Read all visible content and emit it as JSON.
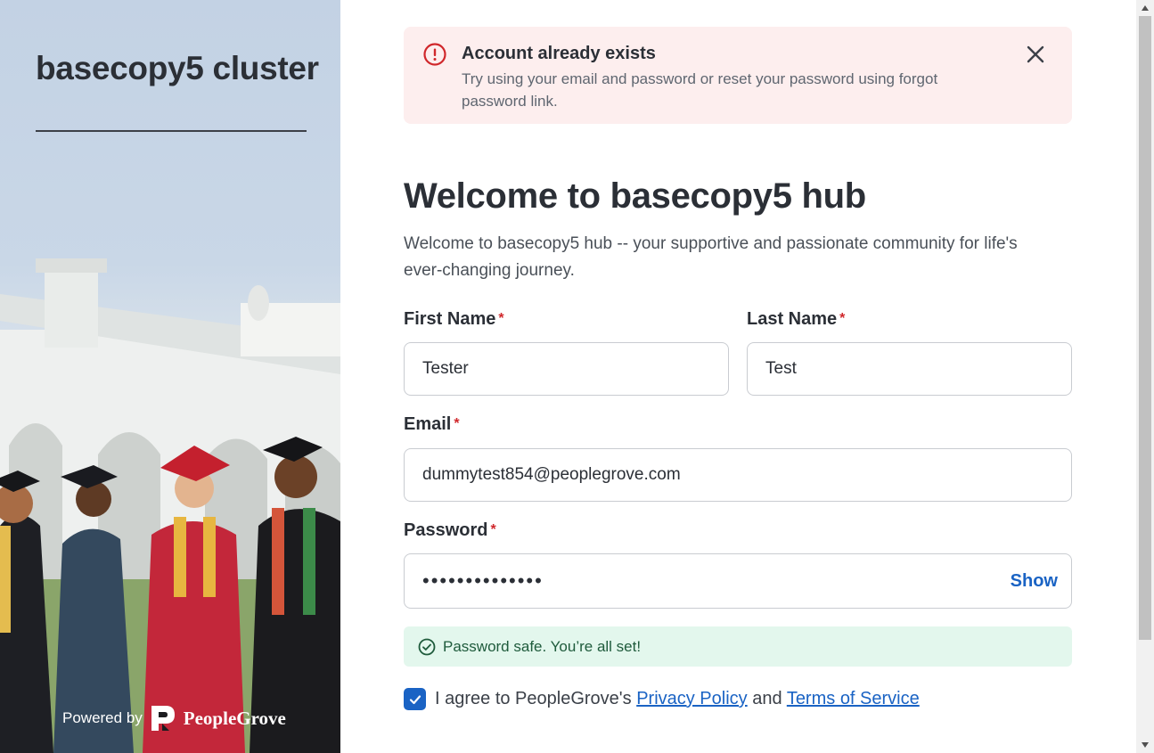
{
  "left_panel": {
    "cluster_title": "basecopy5 cluster",
    "powered_by": "Powered by",
    "brand": "PeopleGrove"
  },
  "alert": {
    "title": "Account already exists",
    "message": "Try using your email and password or reset your password using forgot password link.",
    "icon": "error-icon",
    "close_icon": "close-icon"
  },
  "main": {
    "heading": "Welcome to basecopy5 hub",
    "subheading": "Welcome to basecopy5 hub -- your supportive and passionate community for life's ever-changing journey."
  },
  "form": {
    "required_marker": "*",
    "first_name": {
      "label": "First Name",
      "value": "Tester"
    },
    "last_name": {
      "label": "Last Name",
      "value": "Test"
    },
    "email": {
      "label": "Email",
      "value": "dummytest854@peoplegrove.com"
    },
    "password": {
      "label": "Password",
      "masked_value": "••••••••••••••",
      "show_label": "Show"
    },
    "password_status": "Password safe. You’re all set!",
    "agree": {
      "checked": true,
      "prefix": "I agree to PeopleGrove's",
      "privacy_link": "Privacy Policy",
      "and": "and",
      "terms_link": "Terms of Service"
    }
  },
  "colors": {
    "accent": "#1a63c4",
    "error": "#d0272b",
    "alert_bg": "#fdeeee",
    "success_bg": "#e3f7ed"
  }
}
